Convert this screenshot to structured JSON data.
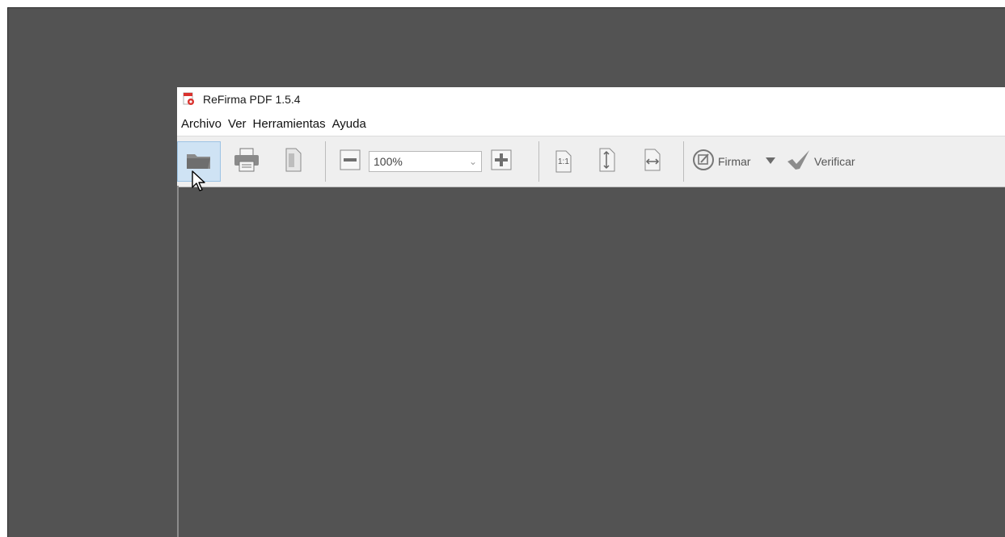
{
  "window": {
    "title": "ReFirma PDF 1.5.4",
    "app_icon": "refirma-pdf-icon"
  },
  "menu": {
    "items": [
      "Archivo",
      "Ver",
      "Herramientas",
      "Ayuda"
    ]
  },
  "toolbar": {
    "open_icon": "folder-open-icon",
    "print_icon": "printer-icon",
    "page_icon": "page-thumbnail-icon",
    "zoom_out_icon": "minus-icon",
    "zoom_value": "100%",
    "zoom_in_icon": "plus-icon",
    "actual_size_label": "1:1",
    "fit_height_icon": "fit-height-icon",
    "fit_width_icon": "fit-width-icon",
    "sign_label": "Firmar",
    "verify_label": "Verificar"
  },
  "colors": {
    "workspace": "#535353",
    "toolbar": "#efefef",
    "selected_button": "#cfe3f4"
  }
}
